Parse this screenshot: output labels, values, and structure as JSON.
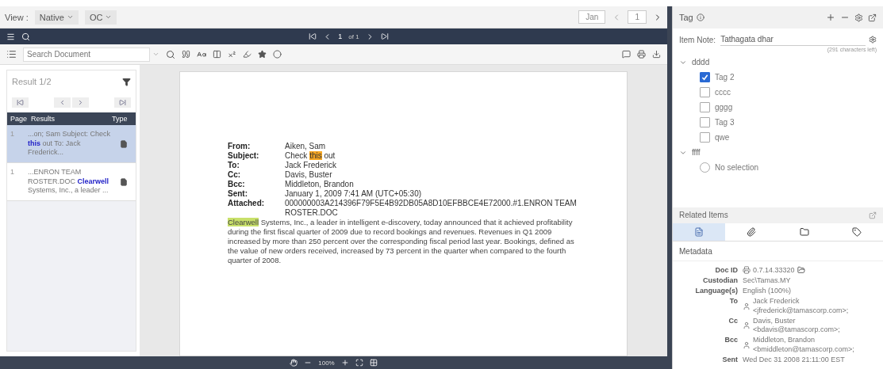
{
  "view_bar": {
    "label": "View :",
    "view_mode": "Native",
    "option": "OC",
    "page_field": "1",
    "page_size": "Jan"
  },
  "nav_bar": {
    "page": "1",
    "of": "of 1"
  },
  "search": {
    "placeholder": "Search Document"
  },
  "results": {
    "title": "Result 1/2",
    "columns": [
      "Page",
      "Results",
      "Type"
    ],
    "rows": [
      {
        "page": "1",
        "snippet": "...on; Sam Subject: Check **this** out To: Jack Frederick...",
        "selected": true
      },
      {
        "page": "1",
        "snippet": "...ENRON TEAM ROSTER.DOC **Clearwell** Systems, Inc., a leader ...",
        "selected": false
      }
    ]
  },
  "document": {
    "fields": [
      {
        "label": "From:",
        "value": [
          {
            "text": "Aiken, Sam"
          }
        ]
      },
      {
        "label": "Subject:",
        "value": [
          {
            "text": "Check "
          },
          {
            "text": "this",
            "color": "#f5a623"
          },
          {
            "text": " out"
          }
        ]
      },
      {
        "label": "To:",
        "value": [
          {
            "text": "Jack Frederick"
          }
        ]
      },
      {
        "label": "Cc:",
        "value": [
          {
            "text": "Davis, Buster"
          }
        ]
      },
      {
        "label": "Bcc:",
        "value": [
          {
            "text": "Middleton, Brandon"
          }
        ]
      },
      {
        "label": "Sent:",
        "value": [
          {
            "text": "January 1, 2009 7:41 AM (UTC+05:30)"
          }
        ]
      },
      {
        "label": "Attached:",
        "value": [
          {
            "text": "000000003A214396F79F5E4B92DB05A8D10EFBBCE4E72000.#1.ENRON TEAM ROSTER.DOC"
          }
        ]
      }
    ],
    "body": [
      {
        "text": "Clearwell",
        "color": "#c8e06a"
      },
      {
        "text": " Systems, Inc., a leader in intelligent e-discovery, today announced that it achieved profitability during the first fiscal quarter of 2009 due to record bookings and revenues. Revenues in Q1 2009 increased by more than 250 percent over the corresponding fiscal period last year. Bookings, defined as the value of new orders received, increased by 73 percent in the quarter when compared to the fourth quarter of 2008."
      }
    ]
  },
  "zoom_bar": {
    "zoom": "100%"
  },
  "tag_panel": {
    "title": "Tag",
    "note_label": "Item Note:",
    "note_value": "Tathagata dhar",
    "note_hint": "(291 characters left)",
    "groups": [
      {
        "name": "dddd",
        "expanded": true,
        "children": [
          {
            "label": "Tag 2",
            "kind": "checkbox",
            "checked": true
          },
          {
            "label": "cccc",
            "kind": "checkbox",
            "checked": false
          },
          {
            "label": "gggg",
            "kind": "checkbox",
            "checked": false
          },
          {
            "label": "Tag 3",
            "kind": "checkbox",
            "checked": false
          },
          {
            "label": "qwe",
            "kind": "checkbox",
            "checked": false
          }
        ]
      },
      {
        "name": "ffff",
        "expanded": true,
        "children": [
          {
            "label": "No selection",
            "kind": "radio",
            "checked": false
          }
        ]
      }
    ]
  },
  "related": {
    "title": "Related Items",
    "tabs": [
      {
        "kind": "document",
        "selected": true
      },
      {
        "kind": "attachment",
        "selected": false
      },
      {
        "kind": "folder",
        "selected": false
      },
      {
        "kind": "tag",
        "selected": false
      }
    ],
    "section": "Metadata",
    "metadata": [
      {
        "label": "Doc ID",
        "value": "0.7.14.33320",
        "kind": "docid"
      },
      {
        "label": "Custodian",
        "value": "Sec\\Tamas.MY",
        "kind": "text"
      },
      {
        "label": "Language(s)",
        "value": "English (100%)",
        "kind": "text"
      },
      {
        "label": "To",
        "value": "Jack Frederick <jfrederick@tamascorp.com>;",
        "kind": "person"
      },
      {
        "label": "Cc",
        "value": "Davis, Buster <bdavis@tamascorp.com>;",
        "kind": "person"
      },
      {
        "label": "Bcc",
        "value": "Middleton, Brandon <bmiddleton@tamascorp.com>;",
        "kind": "person"
      },
      {
        "label": "Sent",
        "value": "Wed Dec 31 2008 21:11:00 EST",
        "kind": "text"
      }
    ]
  }
}
